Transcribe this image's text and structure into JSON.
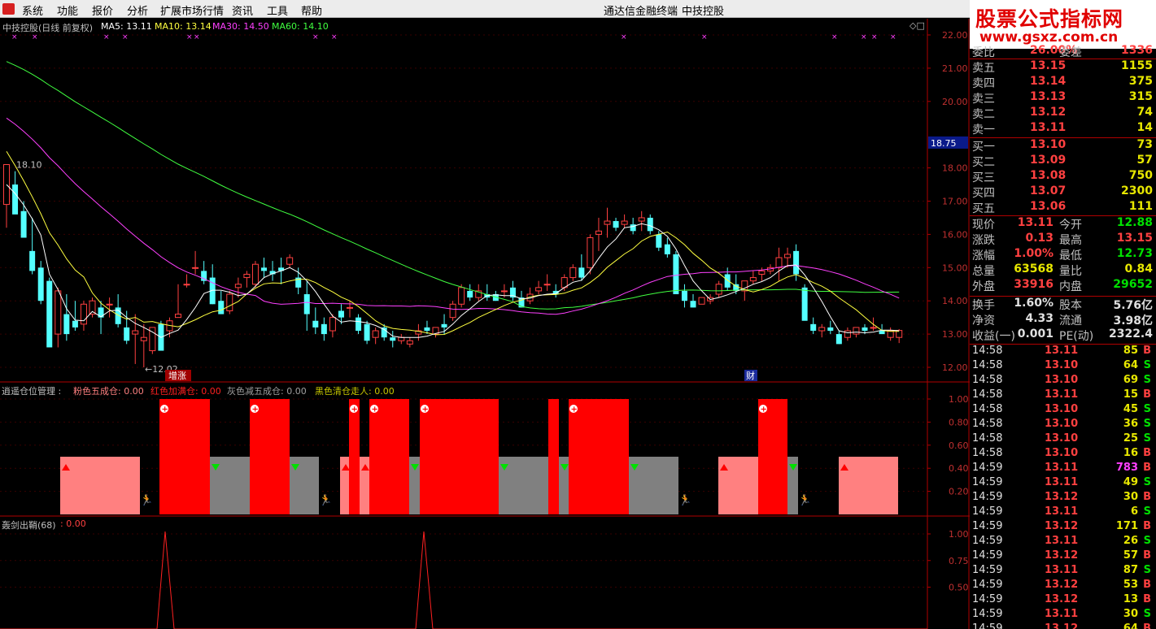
{
  "menu": {
    "items": [
      "系统",
      "功能",
      "报价",
      "分析",
      "扩展市场行情",
      "资讯",
      "工具",
      "帮助"
    ],
    "window_title": "通达信金融终端",
    "stock_name": "中技控股"
  },
  "brand": {
    "title": "股票公式指标网",
    "url": "www.gsxz.com.cn"
  },
  "main_chart": {
    "header": "中技控股(日线 前复权)",
    "ma5": "MA5: 13.11",
    "ma10": "MA10: 13.14",
    "ma30": "MA30: 14.50",
    "ma60": "MA60: 14.10",
    "price_axis": [
      "22.00",
      "21.00",
      "20.00",
      "18.00",
      "17.00",
      "16.00",
      "15.00",
      "14.00",
      "13.00",
      "12.00"
    ],
    "current_price_label": "18.75",
    "high_label": "18.10",
    "low_label": "12.02",
    "event_label_1": "增涨",
    "event_label_2": "财"
  },
  "indicator1": {
    "name": "逍遥仓位管理 :",
    "legend_pink": "粉色五成仓: 0.00",
    "legend_red": "红色加满仓: 0.00",
    "legend_gray": "灰色减五成仓: 0.00",
    "legend_black": "黑色清仓走人: 0.00",
    "axis": [
      "1.00",
      "0.80",
      "0.60",
      "0.40",
      "0.20"
    ]
  },
  "indicator2": {
    "name": "轰剑出鞘(68)",
    "value": ": 0.00",
    "axis": [
      "1.00",
      "0.75",
      "0.50"
    ]
  },
  "quote": {
    "header_left": "委比",
    "header_pct": "26.00%",
    "header_mid": "委差",
    "header_val": "1336",
    "asks": [
      {
        "label": "卖五",
        "price": "13.15",
        "vol": "1155"
      },
      {
        "label": "卖四",
        "price": "13.14",
        "vol": "375"
      },
      {
        "label": "卖三",
        "price": "13.13",
        "vol": "315"
      },
      {
        "label": "卖二",
        "price": "13.12",
        "vol": "74"
      },
      {
        "label": "卖一",
        "price": "13.11",
        "vol": "14"
      }
    ],
    "bids": [
      {
        "label": "买一",
        "price": "13.10",
        "vol": "73"
      },
      {
        "label": "买二",
        "price": "13.09",
        "vol": "57"
      },
      {
        "label": "买三",
        "price": "13.08",
        "vol": "750"
      },
      {
        "label": "买四",
        "price": "13.07",
        "vol": "2300"
      },
      {
        "label": "买五",
        "price": "13.06",
        "vol": "111"
      }
    ],
    "stats": [
      {
        "l1": "现价",
        "v1": "13.11",
        "c1": "red",
        "l2": "今开",
        "v2": "12.88",
        "c2": "green"
      },
      {
        "l1": "涨跌",
        "v1": "0.13",
        "c1": "red",
        "l2": "最高",
        "v2": "13.15",
        "c2": "red"
      },
      {
        "l1": "涨幅",
        "v1": "1.00%",
        "c1": "red",
        "l2": "最低",
        "v2": "12.73",
        "c2": "green"
      },
      {
        "l1": "总量",
        "v1": "63568",
        "c1": "yellow",
        "l2": "量比",
        "v2": "0.84",
        "c2": "yellow"
      },
      {
        "l1": "外盘",
        "v1": "33916",
        "c1": "red",
        "l2": "内盘",
        "v2": "29652",
        "c2": "green"
      },
      {
        "l1": "换手",
        "v1": "1.60%",
        "c1": "white",
        "l2": "股本",
        "v2": "5.76亿",
        "c2": "white"
      },
      {
        "l1": "净资",
        "v1": "4.33",
        "c1": "white",
        "l2": "流通",
        "v2": "3.98亿",
        "c2": "white"
      },
      {
        "l1": "收益(一)",
        "v1": "0.001",
        "c1": "white",
        "l2": "PE(动)",
        "v2": "2322.4",
        "c2": "white"
      }
    ],
    "ticks": [
      {
        "t": "14:58",
        "p": "13.11",
        "v": "85",
        "s": "B"
      },
      {
        "t": "14:58",
        "p": "13.10",
        "v": "64",
        "s": "S"
      },
      {
        "t": "14:58",
        "p": "13.10",
        "v": "69",
        "s": "S"
      },
      {
        "t": "14:58",
        "p": "13.11",
        "v": "15",
        "s": "B"
      },
      {
        "t": "14:58",
        "p": "13.10",
        "v": "45",
        "s": "S"
      },
      {
        "t": "14:58",
        "p": "13.10",
        "v": "36",
        "s": "S"
      },
      {
        "t": "14:58",
        "p": "13.10",
        "v": "25",
        "s": "S"
      },
      {
        "t": "14:58",
        "p": "13.10",
        "v": "16",
        "s": "B"
      },
      {
        "t": "14:59",
        "p": "13.11",
        "v": "783",
        "s": "B"
      },
      {
        "t": "14:59",
        "p": "13.11",
        "v": "49",
        "s": "S"
      },
      {
        "t": "14:59",
        "p": "13.12",
        "v": "30",
        "s": "B"
      },
      {
        "t": "14:59",
        "p": "13.11",
        "v": "6",
        "s": "S"
      },
      {
        "t": "14:59",
        "p": "13.12",
        "v": "171",
        "s": "B"
      },
      {
        "t": "14:59",
        "p": "13.11",
        "v": "26",
        "s": "S"
      },
      {
        "t": "14:59",
        "p": "13.12",
        "v": "57",
        "s": "B"
      },
      {
        "t": "14:59",
        "p": "13.11",
        "v": "87",
        "s": "S"
      },
      {
        "t": "14:59",
        "p": "13.12",
        "v": "53",
        "s": "B"
      },
      {
        "t": "14:59",
        "p": "13.12",
        "v": "13",
        "s": "B"
      },
      {
        "t": "14:59",
        "p": "13.11",
        "v": "30",
        "s": "S"
      },
      {
        "t": "14:59",
        "p": "13.12",
        "v": "64",
        "s": "B"
      }
    ]
  },
  "colors": {
    "up": "#ff4040",
    "down": "#54ffff",
    "ma5": "#ffffff",
    "ma10": "#ffff40",
    "ma30": "#ff40ff",
    "ma60": "#40ff40"
  }
}
